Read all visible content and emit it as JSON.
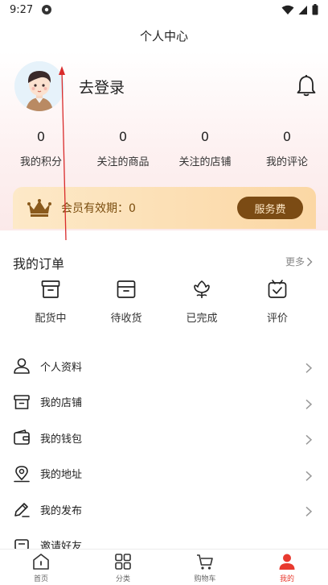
{
  "status_bar": {
    "time": "9:27"
  },
  "header": {
    "title": "个人中心"
  },
  "profile": {
    "login_label": "去登录"
  },
  "stats": [
    {
      "value": "0",
      "label": "我的积分"
    },
    {
      "value": "0",
      "label": "关注的商品"
    },
    {
      "value": "0",
      "label": "关注的店铺"
    },
    {
      "value": "0",
      "label": "我的评论"
    }
  ],
  "member": {
    "text": "会员有效期：0",
    "button_label": "服务费"
  },
  "orders": {
    "title": "我的订单",
    "more_label": "更多",
    "items": [
      {
        "label": "配货中",
        "icon": "box-icon"
      },
      {
        "label": "待收货",
        "icon": "package-icon"
      },
      {
        "label": "已完成",
        "icon": "flower-icon"
      },
      {
        "label": "评价",
        "icon": "review-icon"
      }
    ]
  },
  "menu": [
    {
      "label": "个人资料",
      "icon": "user-icon"
    },
    {
      "label": "我的店铺",
      "icon": "store-icon"
    },
    {
      "label": "我的钱包",
      "icon": "wallet-icon"
    },
    {
      "label": "我的地址",
      "icon": "location-icon"
    },
    {
      "label": "我的发布",
      "icon": "edit-icon"
    },
    {
      "label": "邀请好友",
      "icon": "invite-icon"
    }
  ],
  "tabbar": [
    {
      "label": "首页",
      "icon": "home-icon"
    },
    {
      "label": "分类",
      "icon": "grid-icon"
    },
    {
      "label": "购物车",
      "icon": "cart-icon"
    },
    {
      "label": "我的",
      "icon": "person-icon",
      "active": true
    }
  ],
  "colors": {
    "accent": "#e83a2f",
    "member_button": "#7b4b14"
  }
}
